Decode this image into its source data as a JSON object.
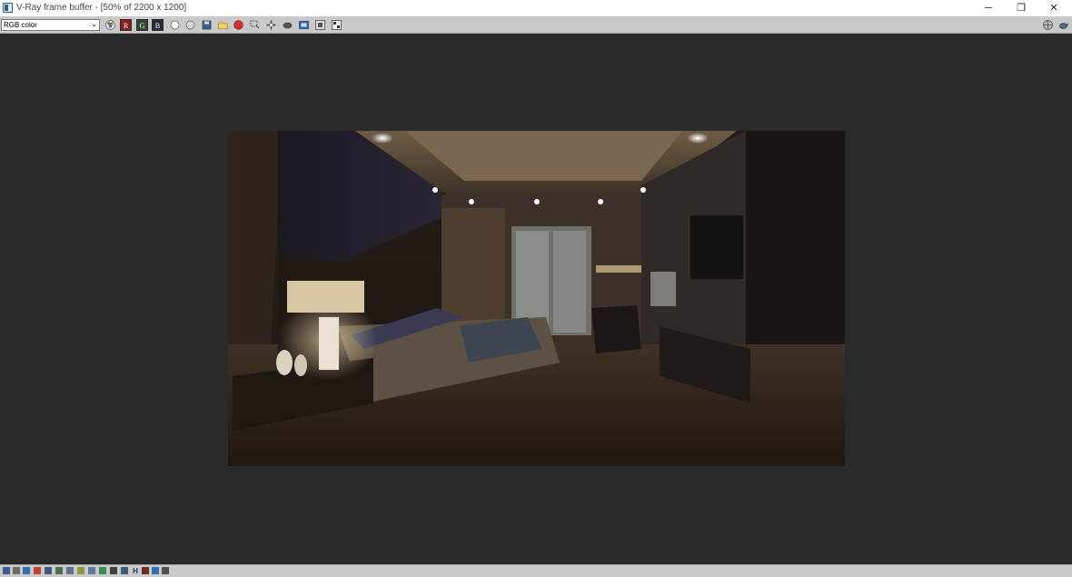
{
  "window": {
    "title": "V-Ray frame buffer - [50% of 2200 x 1200]",
    "minimize_glyph": "─",
    "restore_glyph": "❐",
    "close_glyph": "✕"
  },
  "toolbar": {
    "channel": {
      "selected": "RGB color"
    },
    "channel_buttons": {
      "red": "R",
      "green": "G",
      "blue": "B"
    }
  },
  "statusbar": {
    "h_label": "H"
  },
  "colors": {
    "titlebar_bg": "#ffffff",
    "toolbar_bg": "#c9c9c9",
    "viewport_bg": "#2a2a2a",
    "render_stop_red": "#d83030"
  },
  "icons": [
    "color-correction-icon",
    "white-point-icon",
    "black-point-icon",
    "save-image-icon",
    "open-image-icon",
    "stop-render-icon",
    "region-render-icon",
    "follow-mouse-icon",
    "track-mouse-icon",
    "lens-effects-icon",
    "compare-icon",
    "history-icon",
    "settings-icon",
    "teapot-icon"
  ]
}
